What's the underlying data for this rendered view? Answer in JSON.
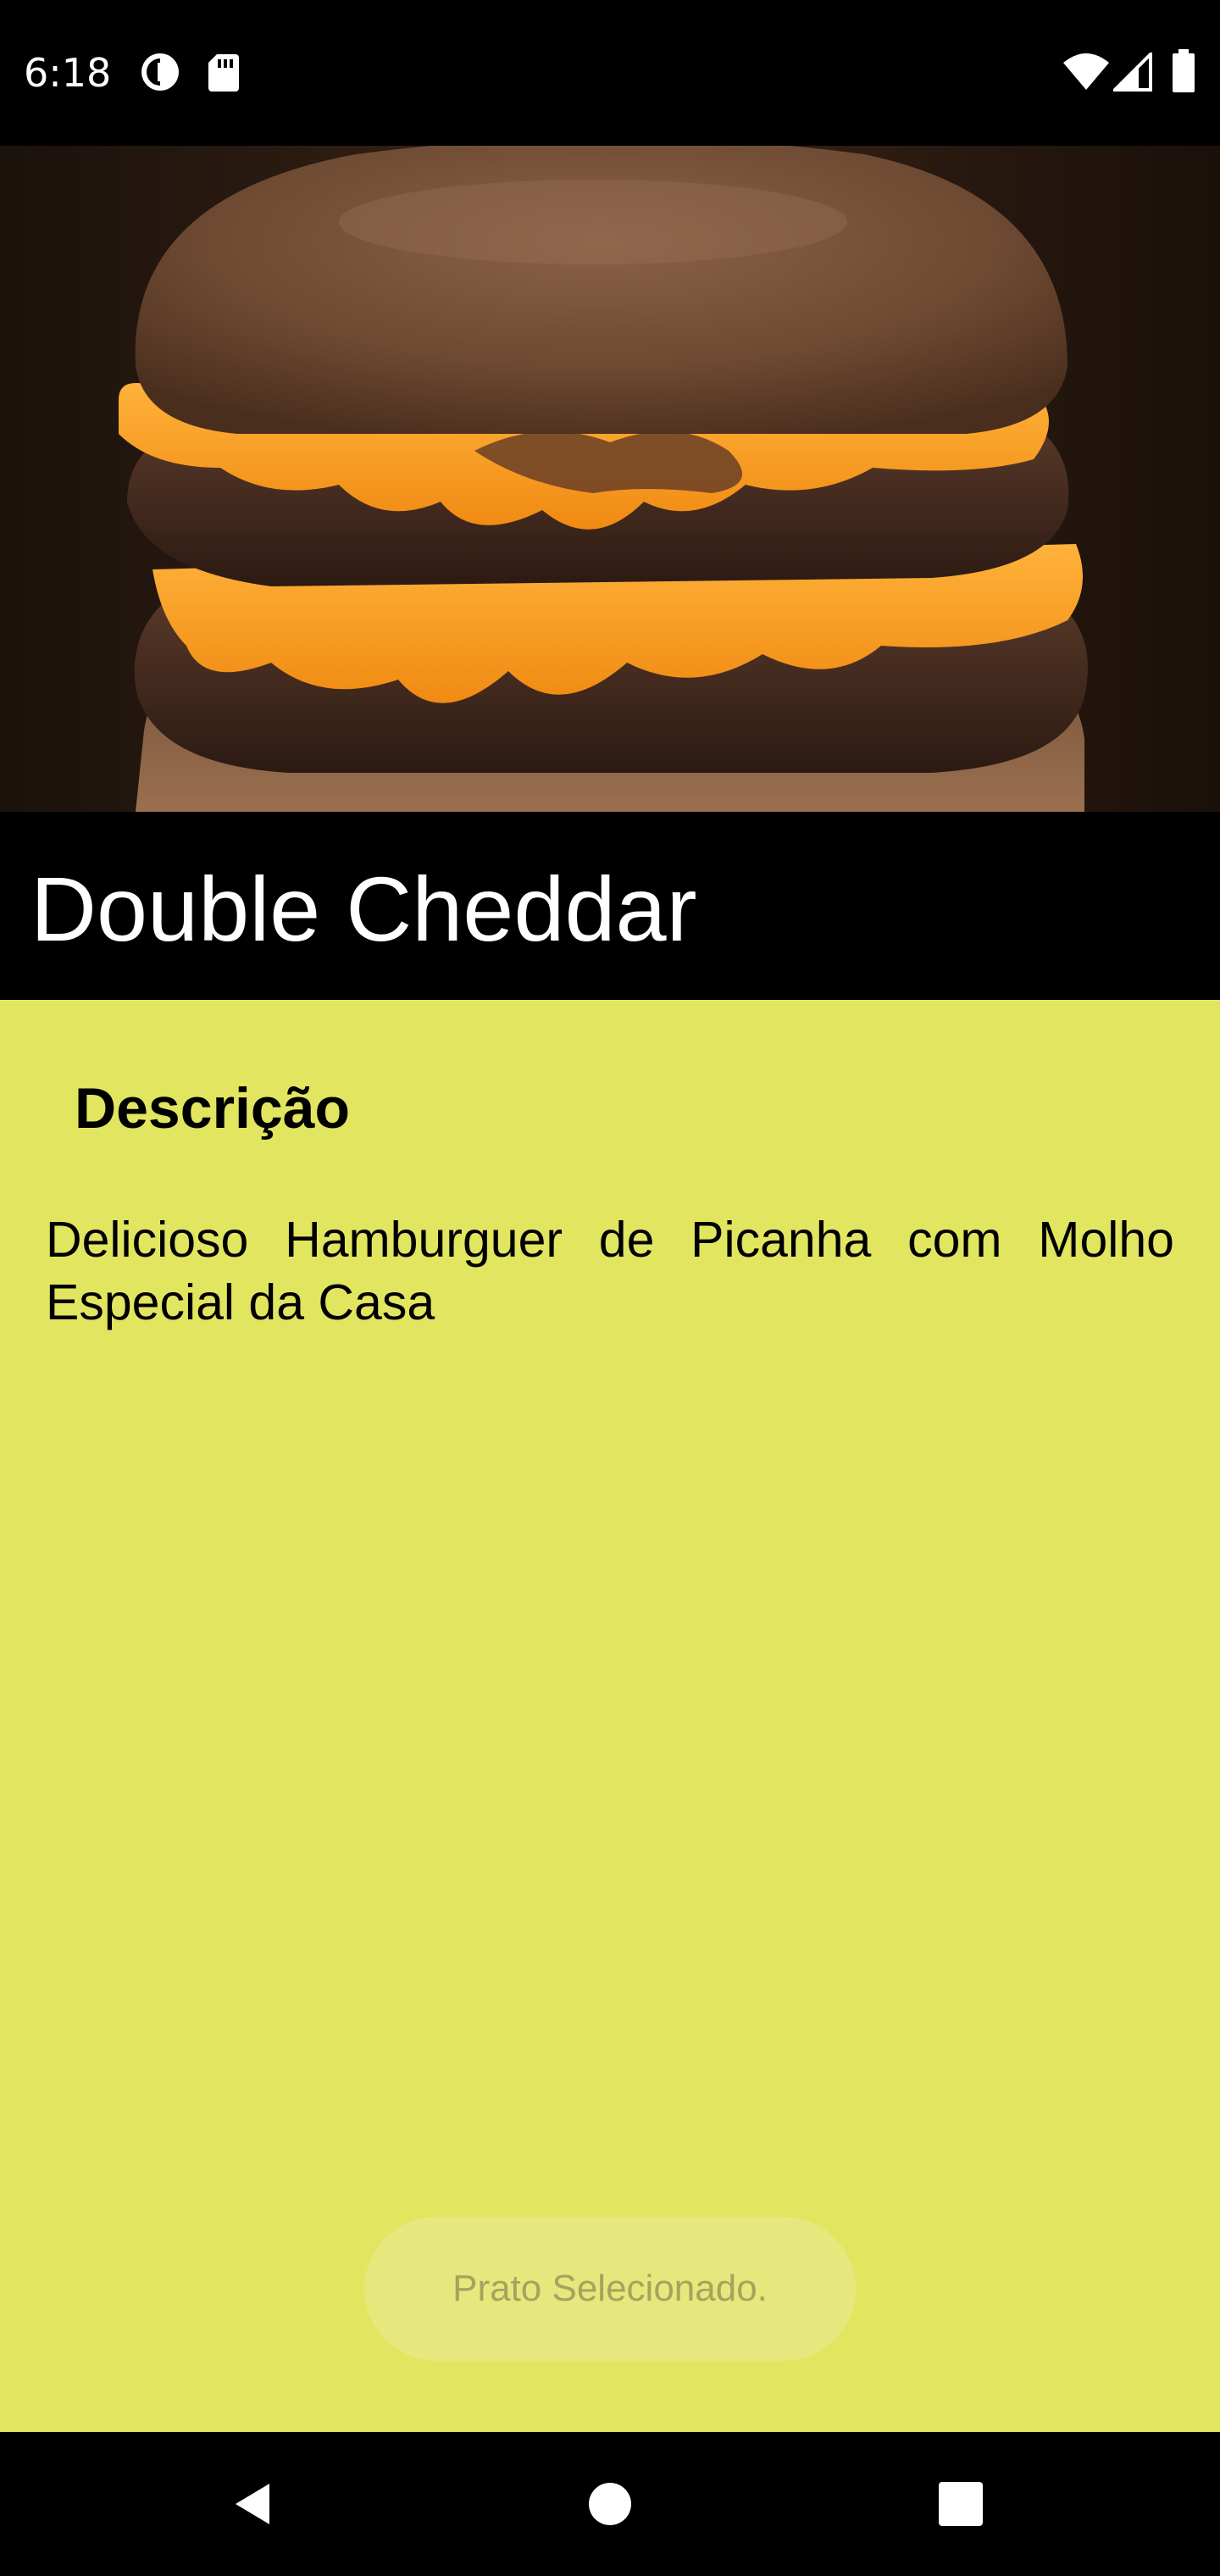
{
  "status_bar": {
    "time": "6:18",
    "left_icons": [
      "data-saver-icon",
      "sd-card-icon"
    ],
    "right_icons": [
      "wifi-icon",
      "cell-signal-icon",
      "battery-icon"
    ]
  },
  "hero": {
    "image": "double-cheddar-burger-photo"
  },
  "dish": {
    "title": "Double Cheddar"
  },
  "details": {
    "heading": "Descrição",
    "description": "Delicioso Hamburguer de Picanha com Molho Especial da Casa"
  },
  "toast": {
    "message": "Prato Selecionado."
  },
  "nav_bar": {
    "buttons": [
      "back-icon",
      "home-icon",
      "recents-icon"
    ]
  },
  "colors": {
    "content_background": "#e2e55f",
    "title_bar_background": "#000000",
    "toast_background": "#e6e87d",
    "toast_text": "#a3a55d"
  }
}
